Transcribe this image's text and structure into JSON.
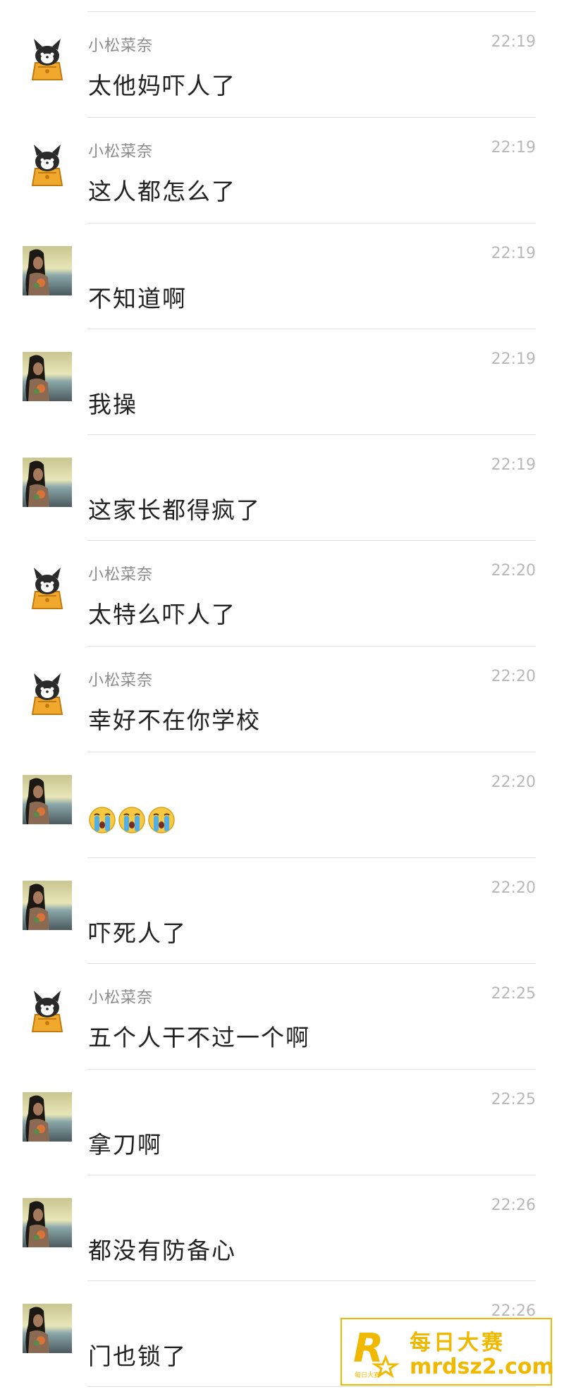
{
  "messages": [
    {
      "sender": "小松菜奈",
      "avatar": "cat-avatar",
      "time": "22:19",
      "text": "太他妈吓人了"
    },
    {
      "sender": "小松菜奈",
      "avatar": "cat-avatar",
      "time": "22:19",
      "text": "这人都怎么了"
    },
    {
      "sender": "",
      "avatar": "girl-avatar",
      "time": "22:19",
      "text": "不知道啊"
    },
    {
      "sender": "",
      "avatar": "girl-avatar",
      "time": "22:19",
      "text": "我操"
    },
    {
      "sender": "",
      "avatar": "girl-avatar",
      "time": "22:19",
      "text": "这家长都得疯了"
    },
    {
      "sender": "小松菜奈",
      "avatar": "cat-avatar",
      "time": "22:20",
      "text": "太特么吓人了"
    },
    {
      "sender": "小松菜奈",
      "avatar": "cat-avatar",
      "time": "22:20",
      "text": "幸好不在你学校"
    },
    {
      "sender": "",
      "avatar": "girl-avatar",
      "time": "22:20",
      "emoji": [
        "crying-emoji",
        "crying-emoji",
        "crying-emoji"
      ]
    },
    {
      "sender": "",
      "avatar": "girl-avatar",
      "time": "22:20",
      "text": "吓死人了"
    },
    {
      "sender": "小松菜奈",
      "avatar": "cat-avatar",
      "time": "22:25",
      "text": "五个人干不过一个啊"
    },
    {
      "sender": "",
      "avatar": "girl-avatar",
      "time": "22:25",
      "text": "拿刀啊"
    },
    {
      "sender": "",
      "avatar": "girl-avatar",
      "time": "22:26",
      "text": "都没有防备心"
    },
    {
      "sender": "",
      "avatar": "girl-avatar",
      "time": "22:26",
      "text": "门也锁了"
    }
  ],
  "watermark": {
    "logo_letter": "R",
    "logo_sub": "每日大赛",
    "name": "每日大赛",
    "url": "mrdsz2.com",
    "color": "#f1b800"
  }
}
